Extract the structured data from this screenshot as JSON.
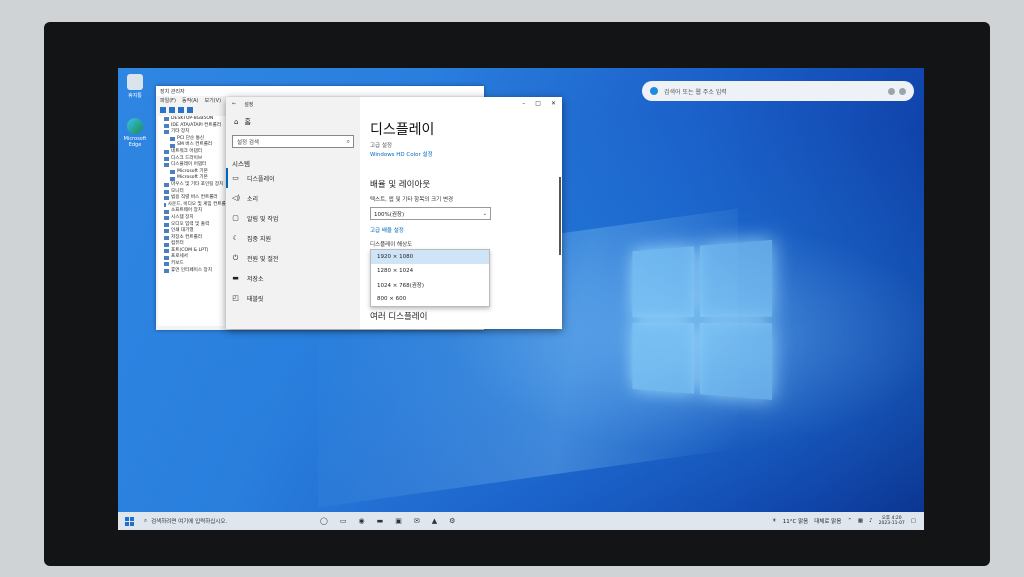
{
  "desktop": {
    "icons": [
      {
        "label": "휴지통"
      },
      {
        "label": "Microsoft Edge"
      }
    ],
    "search_widget": {
      "placeholder": "검색어 또는 웹 주소 입력"
    }
  },
  "device_manager": {
    "title": "장치 관리자",
    "menu": [
      "파일(F)",
      "동작(A)",
      "보기(V)"
    ],
    "tree": [
      "DESKTOP-8GB5ON",
      "IDE ATA/ATAPI 컨트롤러",
      "기타 장치",
      "PCI 단순 통신",
      "SM 버스 컨트롤러",
      "네트워크 어댑터",
      "디스크 드라이브",
      "디스플레이 어댑터",
      "Microsoft 기본",
      "Microsoft 기본",
      "마우스 및 기타 포인팅 장치",
      "모니터",
      "범용 직렬 버스 컨트롤러",
      "사운드, 비디오 및 게임 컨트롤러",
      "소프트웨어 장치",
      "시스템 장치",
      "오디오 입력 및 출력",
      "인쇄 대기열",
      "저장소 컨트롤러",
      "컴퓨터",
      "포트(COM & LPT)",
      "프로세서",
      "키보드",
      "휴먼 인터페이스 장치"
    ]
  },
  "settings": {
    "window_title": "설정",
    "home_label": "홈",
    "search_placeholder": "설정 검색",
    "category": "시스템",
    "nav": [
      {
        "icon": "monitor-icon",
        "label": "디스플레이"
      },
      {
        "icon": "speaker-icon",
        "label": "소리"
      },
      {
        "icon": "notification-icon",
        "label": "알림 및 작업"
      },
      {
        "icon": "moon-icon",
        "label": "집중 지원"
      },
      {
        "icon": "power-icon",
        "label": "전원 및 절전"
      },
      {
        "icon": "storage-icon",
        "label": "저장소"
      },
      {
        "icon": "tablet-icon",
        "label": "태블릿"
      }
    ],
    "page_title": "디스플레이",
    "color_sub": "고급 설정",
    "color_link": "Windows HD Color 설정",
    "section_scale": "배율 및 레이아웃",
    "scale_label": "텍스트, 앱 및 기타 항목의 크기 변경",
    "scale_value": "100%(권장)",
    "advanced_link": "고급 배율 설정",
    "resolution_label": "디스플레이 해상도",
    "resolutions": [
      "1920 × 1080",
      "1280 × 1024",
      "1024 × 768(권장)",
      "800 × 600"
    ],
    "selected_resolution_index": 0,
    "section_multi": "여러 디스플레이"
  },
  "taskbar": {
    "search_placeholder": "검색하려면 여기에 입력하십시오.",
    "weather": "11°C 맑음",
    "weather_sub": "대체로 맑음",
    "clock_time": "오후 4:20",
    "clock_date": "2023-11-07"
  },
  "colors": {
    "accent": "#0067c0",
    "wallpaper": "#1a5fc8"
  }
}
